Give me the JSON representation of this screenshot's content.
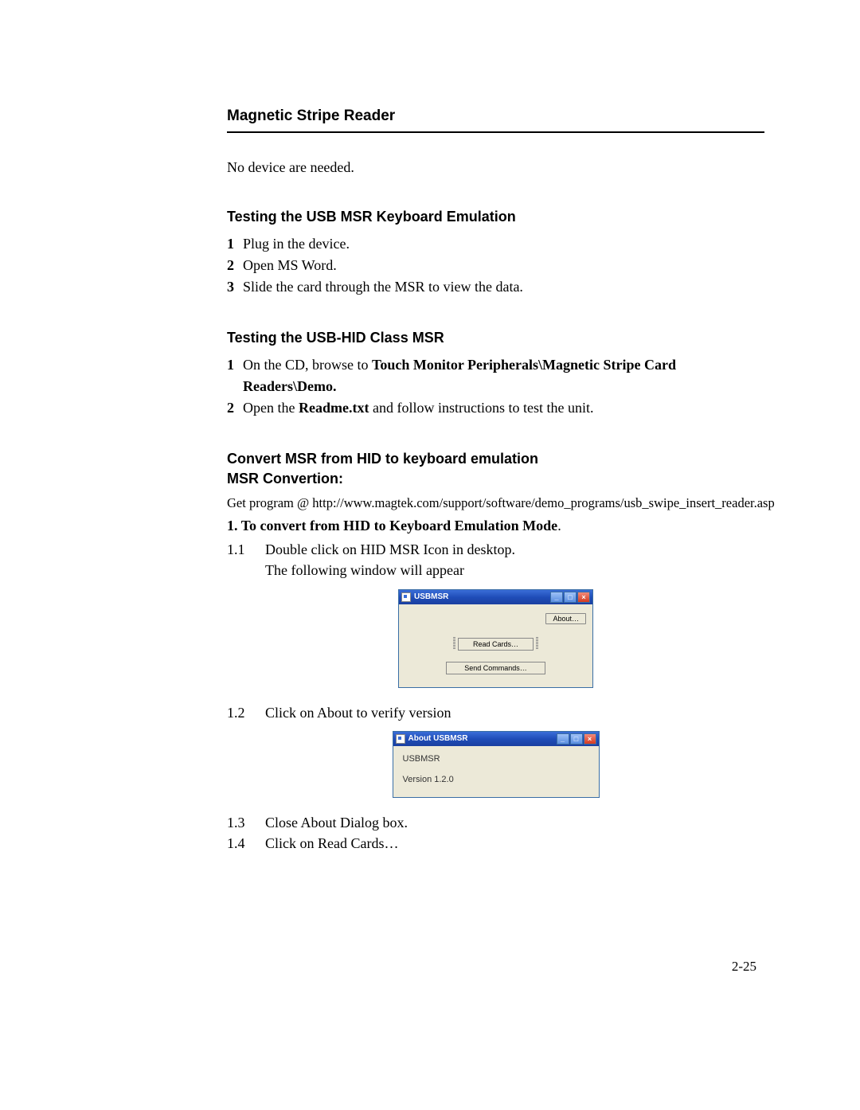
{
  "section_title": "Magnetic Stripe Reader",
  "intro_para": "No device are needed.",
  "sub1_title": "Testing the USB MSR Keyboard Emulation",
  "sub1_items": [
    {
      "num": "1",
      "text": "Plug in the device."
    },
    {
      "num": "2",
      "text": "Open MS Word."
    },
    {
      "num": "3",
      "text": "Slide the card through the MSR to view the data."
    }
  ],
  "sub2_title": "Testing the USB-HID Class MSR",
  "sub2_items": {
    "n1": "1",
    "t1_prefix": "On the CD, browse to ",
    "t1_bold": "Touch Monitor Peripherals\\Magnetic Stripe Card Readers\\Demo.",
    "n2": "2",
    "t2_prefix": "Open the ",
    "t2_bold": "Readme.txt",
    "t2_suffix": " and follow instructions to test the unit."
  },
  "sub3_title_a": "Convert MSR from HID to keyboard emulation",
  "sub3_title_b": "MSR Convertion:",
  "url_line": "Get program @ http://www.magtek.com/support/software/demo_programs/usb_swipe_insert_reader.asp",
  "step_head_num": "1. ",
  "step_head_text": "To convert from HID to Keyboard Emulation Mode",
  "step_head_period": ".",
  "substeps": {
    "s11_num": "1.1",
    "s11_line1": "Double click on HID MSR Icon in desktop.",
    "s11_line2": "The following window will appear",
    "s12_num": "1.2",
    "s12_text": "Click on About to verify version",
    "s13_num": "1.3",
    "s13_text": "Close About Dialog box.",
    "s14_num": "1.4",
    "s14_text": "Click on Read Cards…"
  },
  "dialog1": {
    "title": "USBMSR",
    "about_label": "About…",
    "read_cards_label": "Read Cards…",
    "send_commands_label": "Send Commands…"
  },
  "dialog2": {
    "title": "About USBMSR",
    "line1": "USBMSR",
    "line2": "Version 1.2.0"
  },
  "page_number": "2-25"
}
